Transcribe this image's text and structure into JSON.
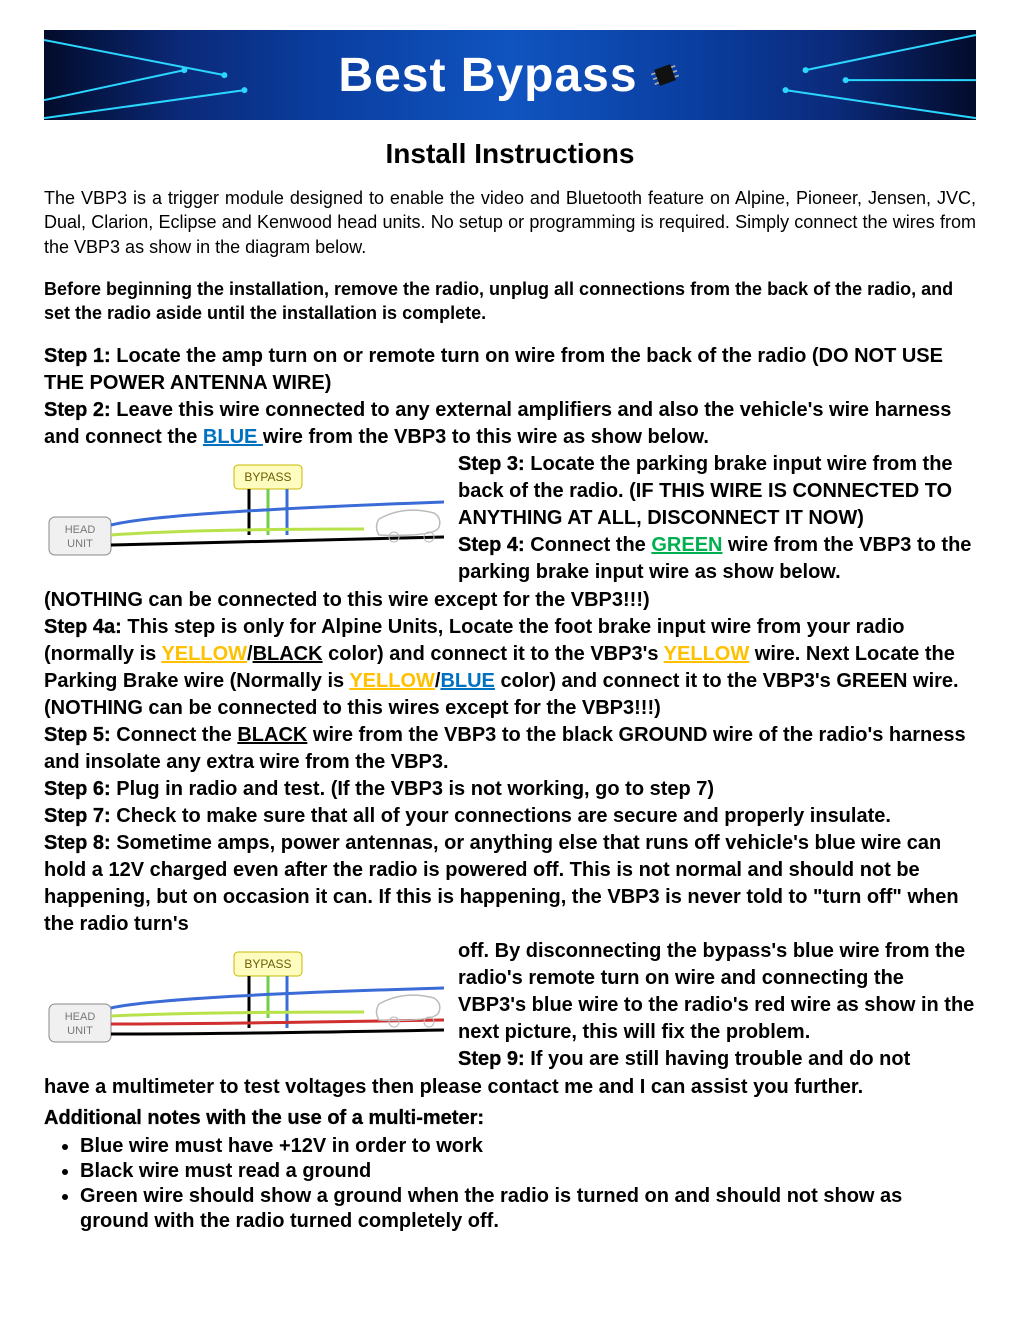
{
  "banner": {
    "title": "Best Bypass"
  },
  "title": "Install Instructions",
  "intro": "The VBP3 is a trigger module designed to enable the video and Bluetooth feature on Alpine, Pioneer, Jensen, JVC, Dual, Clarion, Eclipse and Kenwood head units. No setup or programming is required. Simply connect the wires from the VBP3 as show in the diagram below.",
  "intro_bold": "Before beginning the installation, remove the radio, unplug all connections from the back of the radio, and set the radio aside until the installation is complete.",
  "labels": {
    "step1": "Step 1:",
    "step2": "Step 2:",
    "step3": "Step 3:",
    "step4": "Step 4:",
    "step4a": "Step 4a:",
    "step5": "Step 5:",
    "step6": "Step 6:",
    "step7": "Step 7:",
    "step8": "Step 8:",
    "step9": "Step 9:"
  },
  "steps": {
    "s1": " Locate the amp turn on or remote turn on wire from the back of the radio (DO NOT USE THE POWER ANTENNA WIRE)",
    "s2a": " Leave this wire connected to any external amplifiers and also the vehicle's wire harness and connect the ",
    "s2_blue": "BLUE ",
    "s2b": "wire from the VBP3 to this wire as show below.",
    "s3": " Locate the parking brake input wire from the back of the radio. (IF THIS WIRE IS CONNECTED TO ANYTHING AT ALL, DISCONNECT IT NOW)",
    "s4a_pre": " Connect the ",
    "s4_green": "GREEN",
    "s4a_post": " wire from the VBP3 to the parking brake input wire as show below. ",
    "s4_tail": "(NOTHING can be connected to this wire except for the VBP3!!!)",
    "s4a_1": " This step is only for Alpine Units, Locate the foot brake input wire from your radio (normally is ",
    "yellow": "YELLOW",
    "slash": "/",
    "black": "BLACK",
    "s4a_2": " color) and connect it to the VBP3's ",
    "s4a_3": " wire. Next Locate the Parking Brake wire (Normally is ",
    "blue": "BLUE",
    "s4a_4": " color) and connect it to the VBP3's GREEN wire. (NOTHING can be connected to this wires except for the VBP3!!!)",
    "s5a": " Connect the ",
    "s5b": " wire from the VBP3 to the black GROUND wire of the radio's harness and insolate any extra wire from the VBP3.",
    "s6": " Plug in radio and test. (If the VBP3 is not working, go to step 7)",
    "s7": " Check to make sure that all of your connections are secure and properly insulate.",
    "s8a": " Sometime amps, power antennas, or anything else that runs off vehicle's blue wire can hold a 12V charged even after the radio is powered off. This is not normal and should not be happening, but on occasion it can. If this is happening, the VBP3 is never told to \"turn off\" when the radio turn's ",
    "s8b": "off. By disconnecting the bypass's blue wire from the radio's remote turn on wire and connecting the VBP3's blue wire to the radio's red wire as show in the next picture, this will fix the problem.",
    "s9": " If you are still having trouble and do not ",
    "s9b": "have a multimeter to test voltages then please contact me and I can assist you further."
  },
  "notes_header": "Additional notes with the use of a multi-meter:",
  "notes": {
    "n1": "Blue wire must have +12V in order to work",
    "n2": "Black wire must read a ground",
    "n3": "Green wire should show a ground when the radio is turned on and should not show as ground with the radio turned completely off."
  },
  "diagram": {
    "head_unit": "HEAD\nUNIT",
    "bypass": "BYPASS"
  }
}
